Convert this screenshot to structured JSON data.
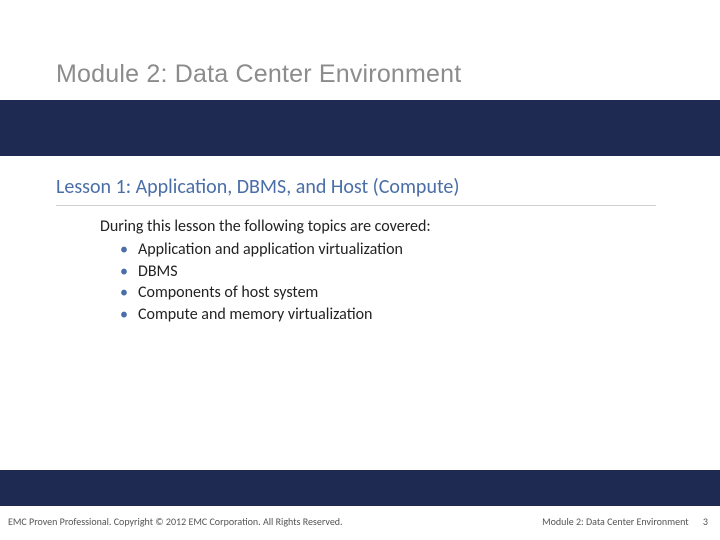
{
  "header": {
    "module_title": "Module 2: Data Center Environment"
  },
  "lesson": {
    "title": "Lesson 1: Application, DBMS, and Host (Compute)",
    "intro": "During this lesson the following topics are covered:",
    "bullets": [
      "Application and application virtualization",
      "DBMS",
      "Components of host system",
      "Compute and memory virtualization"
    ]
  },
  "footer": {
    "left": "EMC Proven Professional. Copyright © 2012 EMC Corporation. All Rights Reserved.",
    "right_module": "Module 2: Data Center Environment",
    "page_number": "3"
  }
}
